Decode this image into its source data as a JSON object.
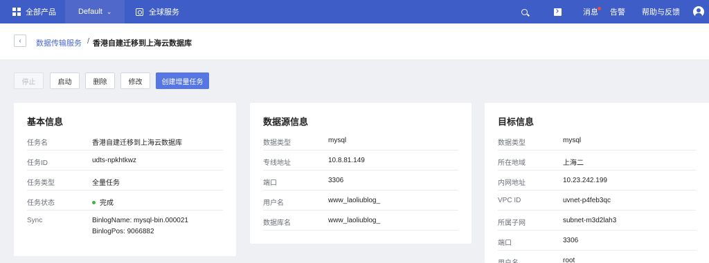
{
  "topbar": {
    "all_products": "全部产品",
    "project": "Default",
    "global_services": "全球服务",
    "messages": "消息",
    "alarms": "告警",
    "help": "帮助与反馈"
  },
  "breadcrumb": {
    "parent": "数据传输服务",
    "separator": "/",
    "current": "香港自建迁移到上海云数据库"
  },
  "actions": {
    "stop": "停止",
    "start": "启动",
    "delete": "删除",
    "modify": "修改",
    "create_incremental": "创建增量任务"
  },
  "basic_info": {
    "title": "基本信息",
    "rows": [
      {
        "label": "任务名",
        "value": "香港自建迁移到上海云数据库"
      },
      {
        "label": "任务ID",
        "value": "udts-npkhtkwz"
      },
      {
        "label": "任务类型",
        "value": "全量任务"
      },
      {
        "label": "任务状态",
        "value": "完成"
      },
      {
        "label": "Sync",
        "value": "BinlogName: mysql-bin.000021",
        "value2": "BinlogPos: 9066882"
      }
    ],
    "status_color": "#3bb44a"
  },
  "source_info": {
    "title": "数据源信息",
    "rows": [
      {
        "label": "数据类型",
        "value": "mysql"
      },
      {
        "label": "专线地址",
        "value": "10.8.81.149"
      },
      {
        "label": "端口",
        "value": "3306"
      },
      {
        "label": "用户名",
        "value": "www_laoliublog_"
      },
      {
        "label": "数据库名",
        "value": "www_laoliublog_"
      }
    ]
  },
  "target_info": {
    "title": "目标信息",
    "rows": [
      {
        "label": "数据类型",
        "value": "mysql"
      },
      {
        "label": "所在地域",
        "value": "上海二"
      },
      {
        "label": "内网地址",
        "value": "10.23.242.199"
      },
      {
        "label": "VPC ID",
        "value": "uvnet-p4feb3qc"
      },
      {
        "label": "所属子网",
        "value": "subnet-m3d2lah3"
      },
      {
        "label": "端口",
        "value": "3306"
      },
      {
        "label": "用户名",
        "value": "root"
      }
    ]
  },
  "colors": {
    "topbar": "#3f5dc7",
    "primary_button": "#5576e3",
    "link": "#4a68d4"
  }
}
